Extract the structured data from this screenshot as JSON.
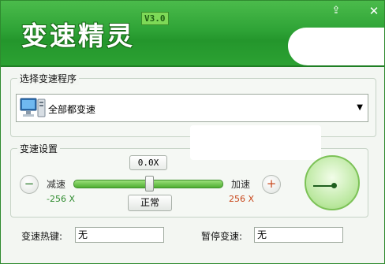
{
  "app": {
    "title": "变速精灵",
    "version": "V3.0"
  },
  "titlebar": {
    "upload_icon": "⇪",
    "close_icon": "✕"
  },
  "program_group": {
    "title": "选择变速程序",
    "selected": "全部都变速"
  },
  "speed_group": {
    "title": "变速设置",
    "current_speed": "0.0X",
    "slow_label": "减速",
    "fast_label": "加速",
    "min_value": "-256 X",
    "max_value": "256 X",
    "normal_button": "正常",
    "minus_icon": "−",
    "plus_icon": "+"
  },
  "hotkeys": {
    "speed_label": "变速热键:",
    "speed_value": "无",
    "pause_label": "暂停变速:",
    "pause_value": "无"
  },
  "colors": {
    "brand_green": "#2ea336",
    "slow_green": "#2e8b2e",
    "fast_orange": "#c8471b"
  }
}
